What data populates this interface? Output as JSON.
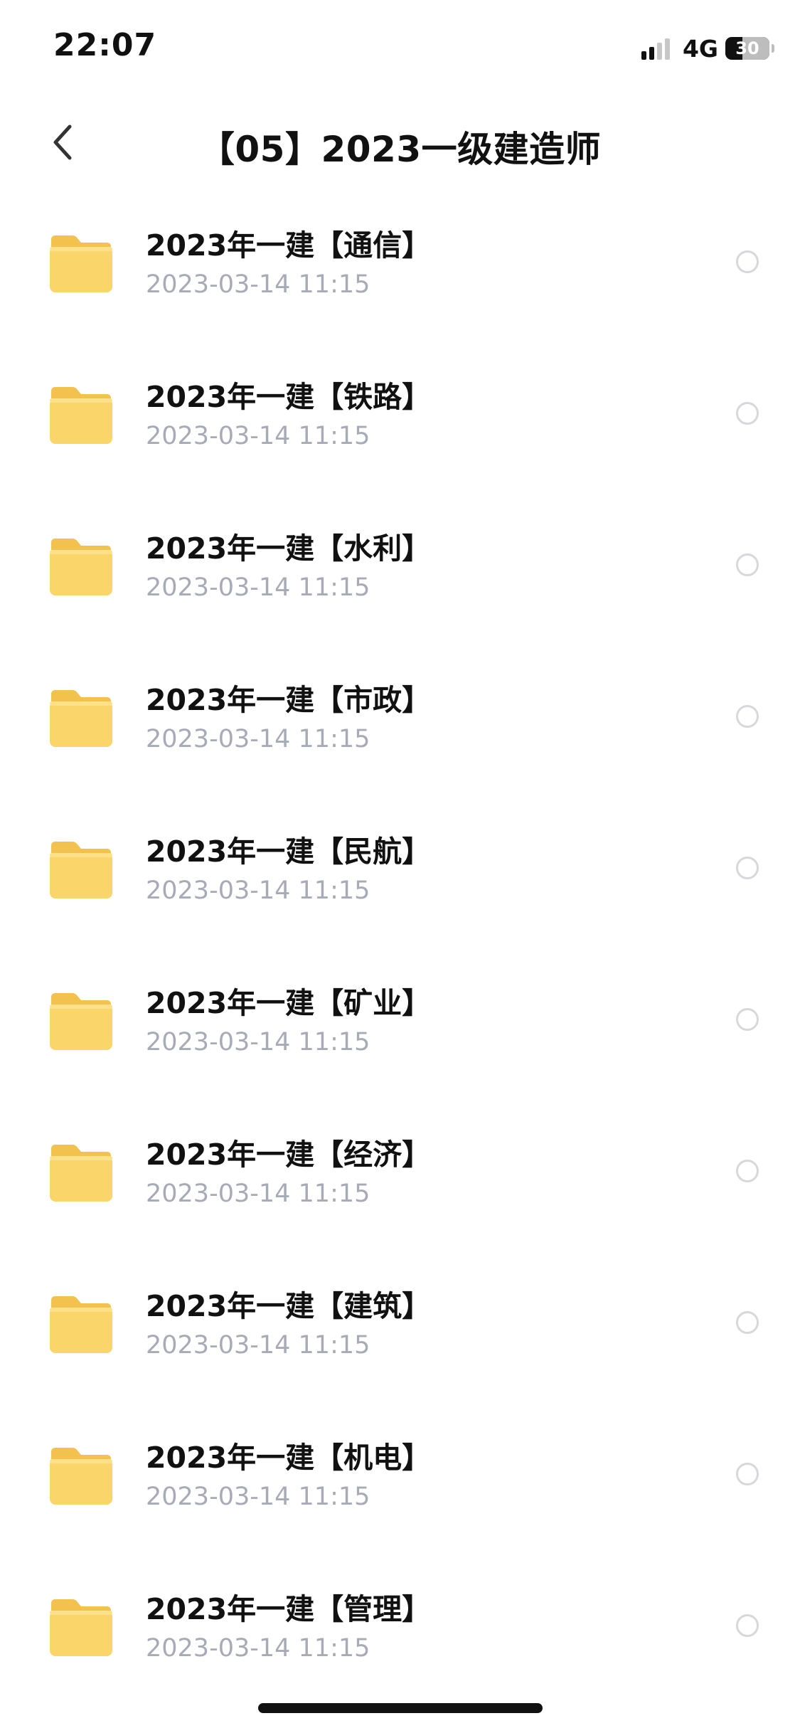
{
  "status_bar": {
    "time": "22:07",
    "network": "4G",
    "battery": "30"
  },
  "nav": {
    "title": "【05】2023一级建造师"
  },
  "colors": {
    "folder": "#F9D56A",
    "folder_light": "#FCE18A",
    "date_text": "#A7ABB6"
  },
  "files": [
    {
      "name": "2023年一建【通信】",
      "date": "2023-03-14 11:15"
    },
    {
      "name": "2023年一建【铁路】",
      "date": "2023-03-14 11:15"
    },
    {
      "name": "2023年一建【水利】",
      "date": "2023-03-14 11:15"
    },
    {
      "name": "2023年一建【市政】",
      "date": "2023-03-14 11:15"
    },
    {
      "name": "2023年一建【民航】",
      "date": "2023-03-14 11:15"
    },
    {
      "name": "2023年一建【矿业】",
      "date": "2023-03-14 11:15"
    },
    {
      "name": "2023年一建【经济】",
      "date": "2023-03-14 11:15"
    },
    {
      "name": "2023年一建【建筑】",
      "date": "2023-03-14 11:15"
    },
    {
      "name": "2023年一建【机电】",
      "date": "2023-03-14 11:15"
    },
    {
      "name": "2023年一建【管理】",
      "date": "2023-03-14 11:15"
    }
  ]
}
